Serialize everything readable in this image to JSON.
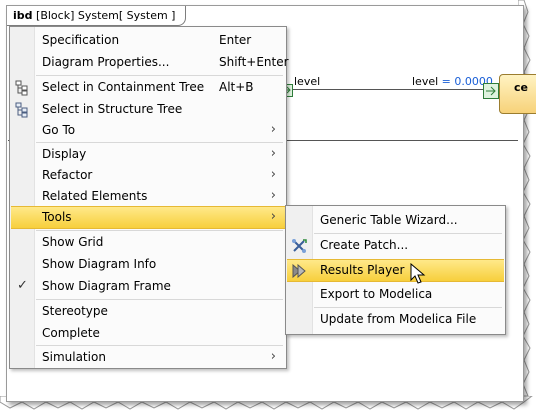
{
  "diagram": {
    "tab_type": "ibd",
    "tab_rest": "[Block] System[ System ]",
    "connector_label": "level",
    "value_name": "level",
    "value_eq": " = ",
    "value_num": "0.0000",
    "block_label": "ce"
  },
  "menu": {
    "items": [
      {
        "label": "Specification",
        "shortcut": "Enter"
      },
      {
        "label": "Diagram Properties...",
        "shortcut": "Shift+Enter"
      },
      {
        "label": "Select in Containment Tree",
        "shortcut": "Alt+B",
        "icon": "containment-tree-icon"
      },
      {
        "label": "Select in Structure Tree",
        "shortcut": "",
        "icon": "structure-tree-icon"
      },
      {
        "label": "Go To",
        "submenu": true
      },
      {
        "label": "Display",
        "submenu": true
      },
      {
        "label": "Refactor",
        "submenu": true
      },
      {
        "label": "Related Elements",
        "submenu": true
      },
      {
        "label": "Tools",
        "submenu": true,
        "active": true
      },
      {
        "label": "Show Grid"
      },
      {
        "label": "Show Diagram Info"
      },
      {
        "label": "Show Diagram Frame",
        "checked": true
      },
      {
        "label": "Stereotype"
      },
      {
        "label": "Complete"
      },
      {
        "label": "Simulation",
        "submenu": true
      }
    ]
  },
  "tools_submenu": {
    "items": [
      {
        "label": "Generic Table Wizard..."
      },
      {
        "label": "Create Patch...",
        "icon": "patch-icon"
      },
      {
        "label": "Results Player",
        "icon": "results-player-icon",
        "active": true
      },
      {
        "label": "Export to Modelica"
      },
      {
        "label": "Update from Modelica File"
      }
    ]
  },
  "glyphs": {
    "arrow": "›",
    "check": "✓"
  },
  "colors": {
    "highlight": "#f7cf3c",
    "value_blue": "#1a5fd6"
  }
}
